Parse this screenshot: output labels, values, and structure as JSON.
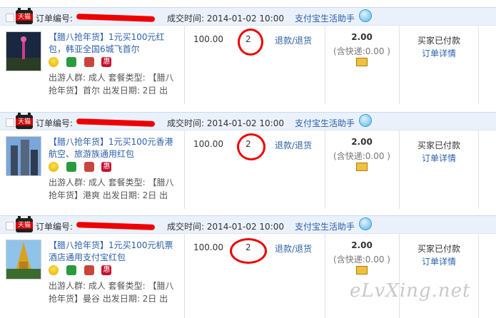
{
  "orders": [
    {
      "order_label": "订单编号:",
      "deal_time": "成交时间: 2014-01-02 10:00",
      "helper": "支付宝生活助手",
      "title": "【腊八抢年货】1元买100元红包，韩亚全国6城飞首尔",
      "info": "出游人群: 成人 套餐类型: 【腊八抢年货】首尔 出发日期: 2日 出",
      "price": "100.00",
      "qty": "2",
      "refund": "退款/退货",
      "total": "2.00",
      "shipping": "(含快递:0.00 )",
      "status": "买家已付款",
      "detail": "订单详情",
      "promo": "惠"
    },
    {
      "order_label": "订单编号:",
      "deal_time": "成交时间: 2014-01-02 10:00",
      "helper": "支付宝生活助手",
      "title": "【腊八抢年货】1元买100元香港航空、旅游族通用红包",
      "info": "出游人群: 成人 套餐类型: 【腊八抢年货】港爽 出发日期: 2日 出",
      "price": "100.00",
      "qty": "2",
      "refund": "退款/退货",
      "total": "2.00",
      "shipping": "(含快递:0.00 )",
      "status": "买家已付款",
      "detail": "订单详情",
      "promo": "惠"
    },
    {
      "order_label": "订单编号:",
      "deal_time": "成交时间: 2014-01-02 10:00",
      "helper": "支付宝生活助手",
      "title": "【腊八抢年货】1元买100元机票酒店通用支付宝红包",
      "info": "出游人群: 成人 套餐类型: 【腊八抢年货】曼谷 出发日期: 2日 出",
      "price": "100.00",
      "qty": "2",
      "refund": "退款/退货",
      "total": "2.00",
      "shipping": "(含快递:0.00 )",
      "status": "买家已付款",
      "detail": "订单详情",
      "promo": "惠"
    }
  ],
  "tmall_label": "天猫",
  "watermark": "eLvXing.net",
  "colors": {
    "link": "#2b5fa8",
    "header_bg": "#eaf1fb",
    "annotation": "#e00"
  }
}
